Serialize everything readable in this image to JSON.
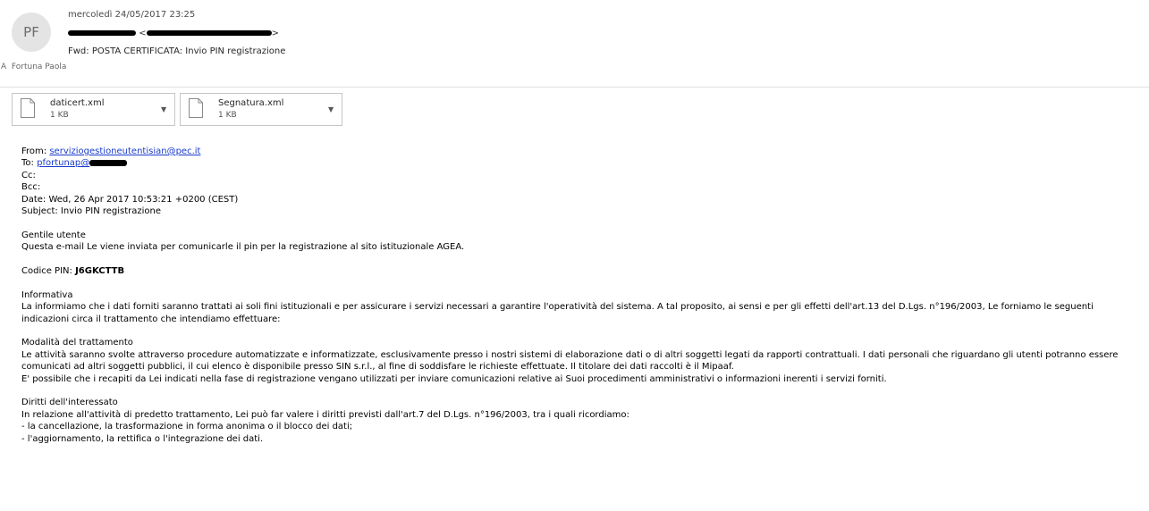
{
  "header": {
    "avatar_initials": "PF",
    "date": "mercoledì 24/05/2017 23:25",
    "sender_lt": "<",
    "sender_gt": ">",
    "subject": "Fwd: POSTA CERTIFICATA: Invio PIN registrazione",
    "to_prefix": "A",
    "to_name": "Fortuna Paola"
  },
  "attachments": [
    {
      "name": "daticert.xml",
      "size": "1 KB",
      "icon": "document-icon"
    },
    {
      "name": "Segnatura.xml",
      "size": "1 KB",
      "icon": "document-icon"
    }
  ],
  "message": {
    "from_label": "From:",
    "from_email": "serviziogestioneutentisian@pec.it",
    "to_label": "To:",
    "to_email": "pfortunap@",
    "cc": "Cc:",
    "bcc": "Bcc:",
    "date": "Date: Wed, 26 Apr 2017 10:53:21 +0200 (CEST)",
    "subject": "Subject: Invio PIN registrazione",
    "greeting": "Gentile utente",
    "intro": "Questa e-mail Le viene inviata per comunicarle il pin per la registrazione al sito istituzionale AGEA.",
    "pin_label": "Codice PIN: ",
    "pin_value": "J6GKCTTB",
    "informativa_title": "Informativa",
    "informativa_text": "La informiamo che i dati forniti saranno trattati ai soli fini istituzionali e per assicurare i servizi necessari a garantire l'operatività del sistema. A tal proposito, ai sensi e per gli effetti dell'art.13 del D.Lgs. n°196/2003, Le forniamo le seguenti indicazioni circa il trattamento che intendiamo effettuare:",
    "modalita_title": "Modalità del trattamento",
    "modalita_text": "Le attività saranno svolte attraverso procedure automatizzate e informatizzate, esclusivamente presso i nostri sistemi di elaborazione dati o di altri soggetti legati da rapporti contrattuali. I dati personali che riguardano gli utenti potranno essere comunicati ad altri soggetti pubblici, il cui elenco è disponibile presso SIN s.r.l., al fine di soddisfare le richieste effettuate. Il titolare dei dati raccolti è il Mipaaf.",
    "modalita_text2": "E' possibile che i recapiti da Lei indicati nella fase di registrazione vengano utilizzati per inviare comunicazioni relative ai Suoi procedimenti amministrativi o informazioni inerenti i servizi forniti.",
    "diritti_title": "Diritti dell'interessato",
    "diritti_text": "In relazione all'attività di predetto trattamento, Lei può far valere i diritti previsti dall'art.7 del D.Lgs. n°196/2003, tra i quali ricordiamo:",
    "diritti_item1": "- la cancellazione, la trasformazione in forma anonima o il blocco dei dati;",
    "diritti_item2": "- l'aggiornamento, la rettifica o l'integrazione dei dati."
  }
}
